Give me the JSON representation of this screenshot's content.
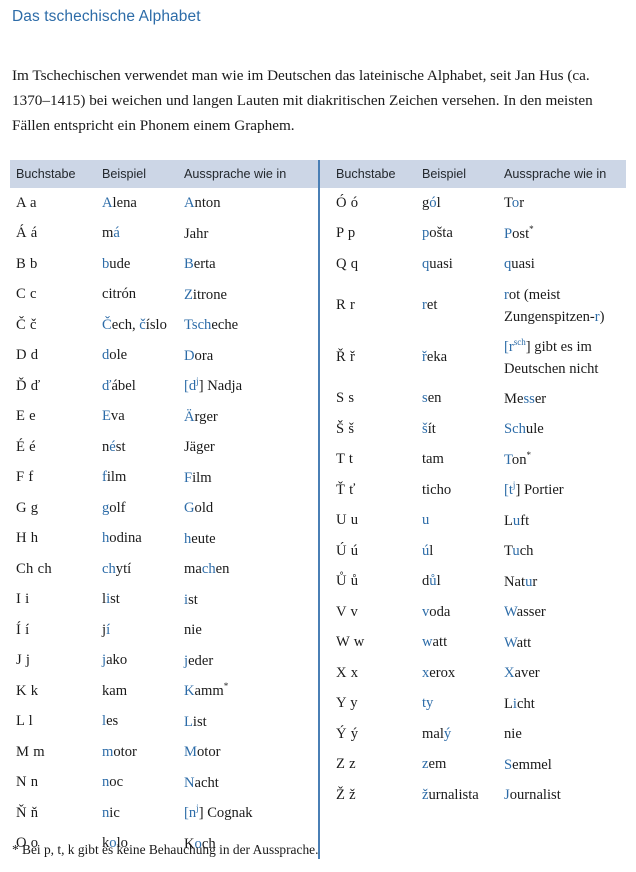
{
  "title": "Das tschechische Alphabet",
  "intro": "Im Tschechischen verwendet man wie im Deutschen das lateinische Alphabet, seit Jan Hus (ca. 1370–1415) bei weichen und langen Lauten mit diakritischen Zeichen versehen. In den meisten Fällen entspricht ein Phonem einem Graphem.",
  "footnote": "* Bei p, t, k gibt es keine Behauchung in der Aussprache.",
  "colors": {
    "accent": "#2d6ca8",
    "header_band": "#ccd6e6",
    "divider": "#4a7fb5",
    "text": "#1a1a1a"
  },
  "table": {
    "headers": [
      "Buchstabe",
      "Beispiel",
      "Aussprache wie in"
    ],
    "left_rows": [
      {
        "letter": "A a",
        "example": "Alena",
        "pron": "Anton"
      },
      {
        "letter": "Á á",
        "example": "má",
        "pron": "Jahr"
      },
      {
        "letter": "B b",
        "example": "bude",
        "pron": "Berta"
      },
      {
        "letter": "C c",
        "example": "citrón",
        "pron": "Zitrone"
      },
      {
        "letter": "Č č",
        "example": "Čech, číslo",
        "pron": "Tscheche"
      },
      {
        "letter": "D d",
        "example": "dole",
        "pron": "Dora"
      },
      {
        "letter": "Ď ď",
        "example": "ďábel",
        "pron": "[dj] Nadja"
      },
      {
        "letter": "E e",
        "example": "Eva",
        "pron": "Ärger"
      },
      {
        "letter": "É é",
        "example": "nést",
        "pron": "Jäger"
      },
      {
        "letter": "F f",
        "example": "film",
        "pron": "Film"
      },
      {
        "letter": "G g",
        "example": "golf",
        "pron": "Gold"
      },
      {
        "letter": "H h",
        "example": "hodina",
        "pron": "heute"
      },
      {
        "letter": "Ch ch",
        "example": "chytí",
        "pron": "machen"
      },
      {
        "letter": "I i",
        "example": "list",
        "pron": "ist"
      },
      {
        "letter": "Í í",
        "example": "jí",
        "pron": "nie"
      },
      {
        "letter": "J j",
        "example": "jako",
        "pron": "jeder"
      },
      {
        "letter": "K k",
        "example": "kam",
        "pron": "Kamm*"
      },
      {
        "letter": "L l",
        "example": "les",
        "pron": "List"
      },
      {
        "letter": "M m",
        "example": "motor",
        "pron": "Motor"
      },
      {
        "letter": "N n",
        "example": "noc",
        "pron": "Nacht"
      },
      {
        "letter": "Ň ň",
        "example": "nic",
        "pron": "[nj] Cognak"
      },
      {
        "letter": "O o",
        "example": "kolo",
        "pron": "Koch"
      }
    ],
    "right_rows": [
      {
        "letter": "Ó ó",
        "example": "gól",
        "pron": "Tor"
      },
      {
        "letter": "P p",
        "example": "pošta",
        "pron": "Post*"
      },
      {
        "letter": "Q q",
        "example": "quasi",
        "pron": "quasi"
      },
      {
        "letter": "R r",
        "example": "ret",
        "pron": "rot (meist Zungenspitzen-r)"
      },
      {
        "letter": "Ř ř",
        "example": "řeka",
        "pron": "[rsch] gibt es im Deutschen nicht"
      },
      {
        "letter": "S s",
        "example": "sen",
        "pron": "Messer"
      },
      {
        "letter": "Š š",
        "example": "šít",
        "pron": "Schule"
      },
      {
        "letter": "T t",
        "example": "tam",
        "pron": "Ton*"
      },
      {
        "letter": "Ť ť",
        "example": "ticho",
        "pron": "[tj] Portier"
      },
      {
        "letter": "U u",
        "example": "u",
        "pron": "Luft"
      },
      {
        "letter": "Ú ú",
        "example": "úl",
        "pron": "Tuch"
      },
      {
        "letter": "Ů ů",
        "example": "důl",
        "pron": "Natur"
      },
      {
        "letter": "V v",
        "example": "voda",
        "pron": "Wasser"
      },
      {
        "letter": "W w",
        "example": "watt",
        "pron": "Watt"
      },
      {
        "letter": "X x",
        "example": "xerox",
        "pron": "Xaver"
      },
      {
        "letter": "Y y",
        "example": "ty",
        "pron": "Licht"
      },
      {
        "letter": "Ý ý",
        "example": "malý",
        "pron": "nie"
      },
      {
        "letter": "Z z",
        "example": "zem",
        "pron": "Semmel"
      },
      {
        "letter": "Ž ž",
        "example": "žurnalista",
        "pron": "Journalist"
      }
    ],
    "left_markup": [
      {
        "example": [
          [
            "A",
            "hl"
          ],
          [
            "lena",
            "dk"
          ]
        ],
        "pron": [
          [
            "A",
            "hl"
          ],
          [
            "nton",
            "dk"
          ]
        ]
      },
      {
        "example": [
          [
            "m",
            "dk"
          ],
          [
            "á",
            "hl"
          ]
        ],
        "pron": [
          [
            "Jahr",
            "dk"
          ]
        ]
      },
      {
        "example": [
          [
            "b",
            "hl"
          ],
          [
            "ude",
            "dk"
          ]
        ],
        "pron": [
          [
            "B",
            "hl"
          ],
          [
            "erta",
            "dk"
          ]
        ]
      },
      {
        "example": [
          [
            "citrón",
            "dk"
          ]
        ],
        "pron": [
          [
            "Z",
            "hl"
          ],
          [
            "itrone",
            "dk"
          ]
        ]
      },
      {
        "example": [
          [
            "Č",
            "hl"
          ],
          [
            "ech, ",
            "dk"
          ],
          [
            "č",
            "hl"
          ],
          [
            "íslo",
            "dk"
          ]
        ],
        "pron": [
          [
            "Tsch",
            "hl"
          ],
          [
            "eche",
            "dk"
          ]
        ]
      },
      {
        "example": [
          [
            "d",
            "hl"
          ],
          [
            "ole",
            "dk"
          ]
        ],
        "pron": [
          [
            "D",
            "hl"
          ],
          [
            "ora",
            "dk"
          ]
        ]
      },
      {
        "example": [
          [
            "ď",
            "hl"
          ],
          [
            "ábel",
            "dk"
          ]
        ],
        "pron": [
          [
            "[d",
            "hl"
          ],
          [
            "SUPj",
            "hl"
          ],
          [
            "] Nadja",
            "dk"
          ]
        ]
      },
      {
        "example": [
          [
            "E",
            "hl"
          ],
          [
            "va",
            "dk"
          ]
        ],
        "pron": [
          [
            "Ä",
            "hl"
          ],
          [
            "rger",
            "dk"
          ]
        ]
      },
      {
        "example": [
          [
            "n",
            "dk"
          ],
          [
            "é",
            "hl"
          ],
          [
            "st",
            "dk"
          ]
        ],
        "pron": [
          [
            "Jäger",
            "dk"
          ]
        ]
      },
      {
        "example": [
          [
            "f",
            "hl"
          ],
          [
            "ilm",
            "dk"
          ]
        ],
        "pron": [
          [
            "F",
            "hl"
          ],
          [
            "ilm",
            "dk"
          ]
        ]
      },
      {
        "example": [
          [
            "g",
            "hl"
          ],
          [
            "olf",
            "dk"
          ]
        ],
        "pron": [
          [
            "G",
            "hl"
          ],
          [
            "old",
            "dk"
          ]
        ]
      },
      {
        "example": [
          [
            "h",
            "hl"
          ],
          [
            "odina",
            "dk"
          ]
        ],
        "pron": [
          [
            "h",
            "hl"
          ],
          [
            "eute",
            "dk"
          ]
        ]
      },
      {
        "example": [
          [
            "ch",
            "hl"
          ],
          [
            "ytí",
            "dk"
          ]
        ],
        "pron": [
          [
            "ma",
            "dk"
          ],
          [
            "ch",
            "hl"
          ],
          [
            "en",
            "dk"
          ]
        ]
      },
      {
        "example": [
          [
            "l",
            "dk"
          ],
          [
            "i",
            "hl"
          ],
          [
            "st",
            "dk"
          ]
        ],
        "pron": [
          [
            "i",
            "hl"
          ],
          [
            "st",
            "dk"
          ]
        ]
      },
      {
        "example": [
          [
            "j",
            "dk"
          ],
          [
            "í",
            "hl"
          ]
        ],
        "pron": [
          [
            "nie",
            "dk"
          ]
        ]
      },
      {
        "example": [
          [
            "j",
            "hl"
          ],
          [
            "ako",
            "dk"
          ]
        ],
        "pron": [
          [
            "j",
            "hl"
          ],
          [
            "eder",
            "dk"
          ]
        ]
      },
      {
        "example": [
          [
            "kam",
            "dk"
          ]
        ],
        "pron": [
          [
            "K",
            "hl"
          ],
          [
            "amm",
            "dk"
          ],
          [
            "SUP*",
            "dk"
          ]
        ]
      },
      {
        "example": [
          [
            "l",
            "hl"
          ],
          [
            "es",
            "dk"
          ]
        ],
        "pron": [
          [
            "L",
            "hl"
          ],
          [
            "ist",
            "dk"
          ]
        ]
      },
      {
        "example": [
          [
            "m",
            "hl"
          ],
          [
            "otor",
            "dk"
          ]
        ],
        "pron": [
          [
            "M",
            "hl"
          ],
          [
            "otor",
            "dk"
          ]
        ]
      },
      {
        "example": [
          [
            "n",
            "hl"
          ],
          [
            "oc",
            "dk"
          ]
        ],
        "pron": [
          [
            "N",
            "hl"
          ],
          [
            "acht",
            "dk"
          ]
        ]
      },
      {
        "example": [
          [
            "n",
            "hl"
          ],
          [
            "ic",
            "dk"
          ]
        ],
        "pron": [
          [
            "[n",
            "hl"
          ],
          [
            "SUPj",
            "hl"
          ],
          [
            "] Cognak",
            "dk"
          ]
        ]
      },
      {
        "example": [
          [
            "k",
            "dk"
          ],
          [
            "o",
            "hl"
          ],
          [
            "lo",
            "dk"
          ]
        ],
        "pron": [
          [
            "K",
            "dk"
          ],
          [
            "o",
            "hl"
          ],
          [
            "ch",
            "dk"
          ]
        ]
      }
    ],
    "right_markup": [
      {
        "example": [
          [
            "g",
            "dk"
          ],
          [
            "ó",
            "hl"
          ],
          [
            "l",
            "dk"
          ]
        ],
        "pron": [
          [
            "T",
            "dk"
          ],
          [
            "o",
            "hl"
          ],
          [
            "r",
            "dk"
          ]
        ]
      },
      {
        "example": [
          [
            "p",
            "hl"
          ],
          [
            "ošta",
            "dk"
          ]
        ],
        "pron": [
          [
            "P",
            "hl"
          ],
          [
            "ost",
            "dk"
          ],
          [
            "SUP*",
            "dk"
          ]
        ]
      },
      {
        "example": [
          [
            "q",
            "hl"
          ],
          [
            "uasi",
            "dk"
          ]
        ],
        "pron": [
          [
            "q",
            "hl"
          ],
          [
            "uasi",
            "dk"
          ]
        ]
      },
      {
        "example": [
          [
            "r",
            "hl"
          ],
          [
            "et",
            "dk"
          ]
        ],
        "pron": [
          [
            "r",
            "hl"
          ],
          [
            "ot (meist Zungenspitzen-",
            "dk"
          ],
          [
            "r",
            "hl"
          ],
          [
            ")",
            "dk"
          ]
        ]
      },
      {
        "example": [
          [
            "ř",
            "hl"
          ],
          [
            "eka",
            "dk"
          ]
        ],
        "pron": [
          [
            "[r",
            "hl"
          ],
          [
            "SUPsch",
            "hl"
          ],
          [
            "] gibt es im Deutschen nicht",
            "dk"
          ]
        ]
      },
      {
        "example": [
          [
            "s",
            "hl"
          ],
          [
            "en",
            "dk"
          ]
        ],
        "pron": [
          [
            "Me",
            "dk"
          ],
          [
            "ss",
            "hl"
          ],
          [
            "er",
            "dk"
          ]
        ]
      },
      {
        "example": [
          [
            "š",
            "hl"
          ],
          [
            "ít",
            "dk"
          ]
        ],
        "pron": [
          [
            "Sch",
            "hl"
          ],
          [
            "ule",
            "dk"
          ]
        ]
      },
      {
        "example": [
          [
            "tam",
            "dk"
          ]
        ],
        "pron": [
          [
            "T",
            "hl"
          ],
          [
            "on",
            "dk"
          ],
          [
            "SUP*",
            "dk"
          ]
        ]
      },
      {
        "example": [
          [
            "ticho",
            "dk"
          ]
        ],
        "pron": [
          [
            "[t",
            "hl"
          ],
          [
            "SUPj",
            "hl"
          ],
          [
            "] Portier",
            "dk"
          ]
        ]
      },
      {
        "example": [
          [
            "u",
            "hl"
          ]
        ],
        "pron": [
          [
            "L",
            "dk"
          ],
          [
            "u",
            "hl"
          ],
          [
            "ft",
            "dk"
          ]
        ]
      },
      {
        "example": [
          [
            "ú",
            "hl"
          ],
          [
            "l",
            "dk"
          ]
        ],
        "pron": [
          [
            "T",
            "dk"
          ],
          [
            "u",
            "hl"
          ],
          [
            "ch",
            "dk"
          ]
        ]
      },
      {
        "example": [
          [
            "d",
            "dk"
          ],
          [
            "ů",
            "hl"
          ],
          [
            "l",
            "dk"
          ]
        ],
        "pron": [
          [
            "Nat",
            "dk"
          ],
          [
            "u",
            "hl"
          ],
          [
            "r",
            "dk"
          ]
        ]
      },
      {
        "example": [
          [
            "v",
            "hl"
          ],
          [
            "oda",
            "dk"
          ]
        ],
        "pron": [
          [
            "W",
            "hl"
          ],
          [
            "asser",
            "dk"
          ]
        ]
      },
      {
        "example": [
          [
            "w",
            "hl"
          ],
          [
            "att",
            "dk"
          ]
        ],
        "pron": [
          [
            "W",
            "hl"
          ],
          [
            "att",
            "dk"
          ]
        ]
      },
      {
        "example": [
          [
            "x",
            "hl"
          ],
          [
            "erox",
            "dk"
          ]
        ],
        "pron": [
          [
            "X",
            "hl"
          ],
          [
            "aver",
            "dk"
          ]
        ]
      },
      {
        "example": [
          [
            "ty",
            "hl"
          ]
        ],
        "pron": [
          [
            "L",
            "dk"
          ],
          [
            "i",
            "hl"
          ],
          [
            "cht",
            "dk"
          ]
        ]
      },
      {
        "example": [
          [
            "mal",
            "dk"
          ],
          [
            "ý",
            "hl"
          ]
        ],
        "pron": [
          [
            "nie",
            "dk"
          ]
        ]
      },
      {
        "example": [
          [
            "z",
            "hl"
          ],
          [
            "em",
            "dk"
          ]
        ],
        "pron": [
          [
            "S",
            "hl"
          ],
          [
            "emmel",
            "dk"
          ]
        ]
      },
      {
        "example": [
          [
            "ž",
            "hl"
          ],
          [
            "urnalista",
            "dk"
          ]
        ],
        "pron": [
          [
            "J",
            "hl"
          ],
          [
            "ournalist",
            "dk"
          ]
        ]
      }
    ]
  }
}
